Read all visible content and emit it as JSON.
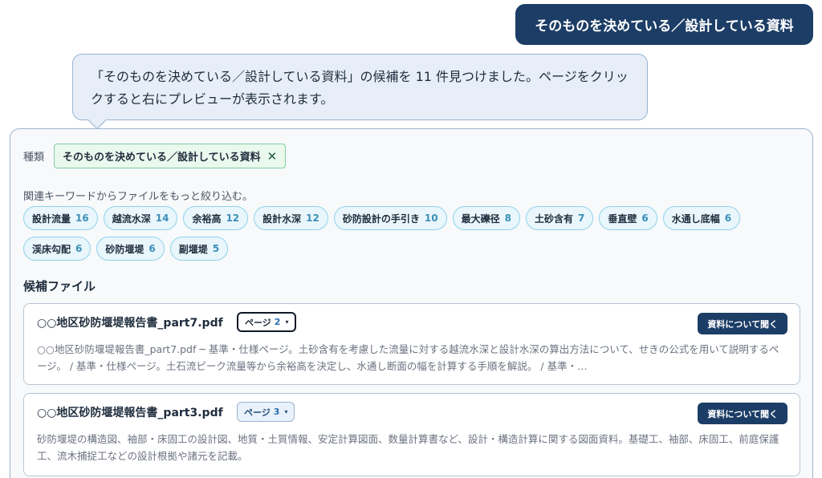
{
  "user_message": "そのものを決めている／設計している資料",
  "assistant_message": "「そのものを決めている／設計している資料」の候補を 11 件見つけました。ページをクリックすると右にプレビューが表示されます。",
  "filter": {
    "kind_label": "種類",
    "kind_chip": "そのものを決めている／設計している資料",
    "remove_symbol": "✕"
  },
  "keywords": {
    "heading": "関連キーワードからファイルをもっと絞り込む。",
    "items": [
      {
        "label": "設計流量",
        "count": "16"
      },
      {
        "label": "越流水深",
        "count": "14"
      },
      {
        "label": "余裕高",
        "count": "12"
      },
      {
        "label": "設計水深",
        "count": "12"
      },
      {
        "label": "砂防設計の手引き",
        "count": "10"
      },
      {
        "label": "最大礫径",
        "count": "8"
      },
      {
        "label": "土砂含有",
        "count": "7"
      },
      {
        "label": "垂直壁",
        "count": "6"
      },
      {
        "label": "水通し底幅",
        "count": "6"
      },
      {
        "label": "渓床勾配",
        "count": "6"
      },
      {
        "label": "砂防堰堤",
        "count": "6"
      },
      {
        "label": "副堰堤",
        "count": "5"
      }
    ]
  },
  "candidates": {
    "heading": "候補ファイル",
    "files": [
      {
        "title": "○○地区砂防堰堤報告書_part7.pdf",
        "page_label": "ページ",
        "page_num": "2",
        "open_label": "資料について聞く",
        "description": "○○地区砂防堰堤報告書_part7.pdf ─ 基準・仕様ページ。土砂含有を考慮した流量に対する越流水深と設計水深の算出方法について、せきの公式を用いて説明するページ。 / 基準・仕様ページ。土石流ピーク流量等から余裕高を決定し、水通し断面の幅を計算する手順を解説。 / 基準・…"
      },
      {
        "title": "○○地区砂防堰堤報告書_part3.pdf",
        "page_label": "ページ",
        "page_num": "3",
        "open_label": "資料について聞く",
        "description": "砂防堰堤の構造図、袖部・床固工の設計図、地質・土質情報、安定計算図面、数量計算書など、設計・構造計算に関する図面資料。基礎工、袖部、床固工、前庭保護工、流木捕捉工などの設計根拠や諸元を記載。"
      }
    ]
  },
  "icons": {
    "caret": "▾"
  }
}
